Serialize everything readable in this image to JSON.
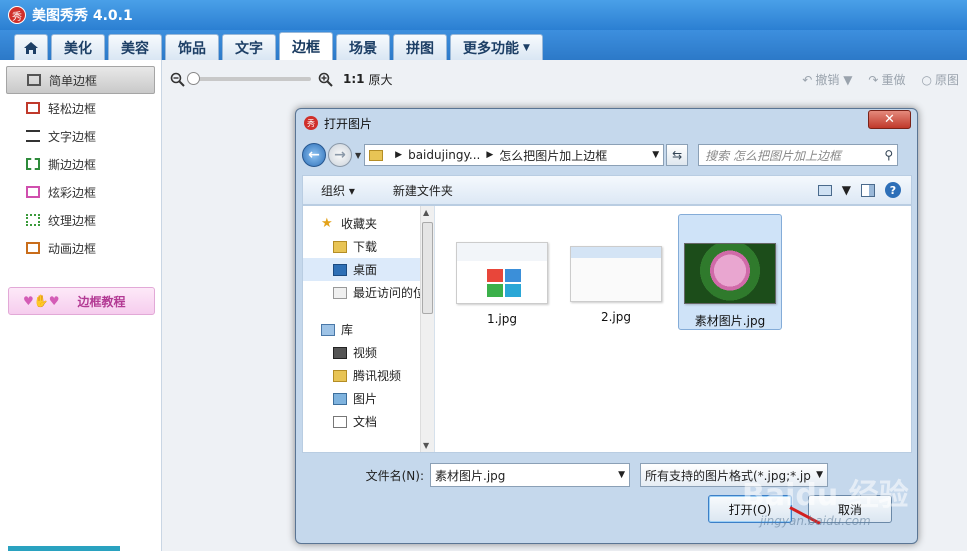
{
  "app": {
    "logo": "秀",
    "title": "美图秀秀 4.0.1"
  },
  "tabs": [
    {
      "label": "美化"
    },
    {
      "label": "美容"
    },
    {
      "label": "饰品"
    },
    {
      "label": "文字"
    },
    {
      "label": "边框"
    },
    {
      "label": "场景"
    },
    {
      "label": "拼图"
    },
    {
      "label": "更多功能"
    }
  ],
  "sidebar": {
    "items": [
      {
        "label": "简单边框"
      },
      {
        "label": "轻松边框"
      },
      {
        "label": "文字边框"
      },
      {
        "label": "撕边边框"
      },
      {
        "label": "炫彩边框"
      },
      {
        "label": "纹理边框"
      },
      {
        "label": "动画边框"
      }
    ],
    "tutorial_label": "边框教程"
  },
  "toolbar": {
    "zoom_ratio": "1:1",
    "zoom_orig": "原大",
    "undo_label": "撤销",
    "redo_label": "重做",
    "original_label": "原图"
  },
  "dialog": {
    "logo": "秀",
    "title": "打开图片",
    "path": {
      "part1": "baidujingy...",
      "part2": "怎么把图片加上边框"
    },
    "search_placeholder": "搜索 怎么把图片加上边框",
    "organize_label": "组织",
    "new_folder_label": "新建文件夹",
    "nav": {
      "favorites": "收藏夹",
      "downloads": "下载",
      "desktop": "桌面",
      "recent": "最近访问的位",
      "libraries": "库",
      "videos": "视频",
      "tencent_video": "腾讯视频",
      "pictures": "图片",
      "documents": "文档"
    },
    "files": [
      {
        "name": "1.jpg"
      },
      {
        "name": "2.jpg"
      },
      {
        "name": "素材图片.jpg"
      }
    ],
    "filename_label": "文件名(N):",
    "filename_value": "素材图片.jpg",
    "filetype_value": "所有支持的图片格式(*.jpg;*.jp",
    "open_label": "打开(O)",
    "cancel_label": "取消"
  },
  "watermark": {
    "main": "Baidu 经验",
    "sub": "jingyan.baidu.com"
  }
}
